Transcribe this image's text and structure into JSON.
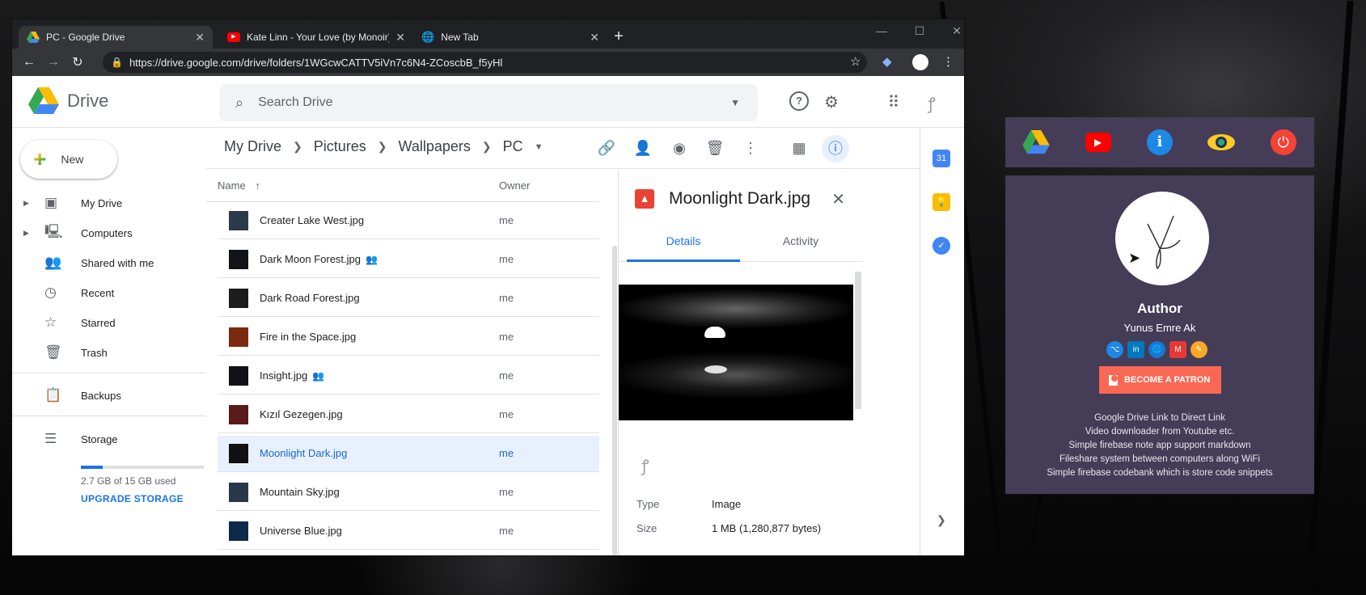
{
  "browser": {
    "tabs": [
      {
        "title": "PC - Google Drive",
        "icon": "google-drive-icon"
      },
      {
        "title": "Kate Linn - Your Love (by Monoir)",
        "icon": "youtube-icon"
      },
      {
        "title": "New Tab",
        "icon": "globe-icon"
      }
    ],
    "url": "https://drive.google.com/drive/folders/1WGcwCATTV5iVn7c6N4-ZCoscbB_f5yHl"
  },
  "drive": {
    "app_name": "Drive",
    "search_placeholder": "Search Drive",
    "new_label": "New",
    "nav": [
      {
        "label": "My Drive",
        "icon": "my-drive-icon",
        "expandable": true
      },
      {
        "label": "Computers",
        "icon": "computers-icon",
        "expandable": true
      },
      {
        "label": "Shared with me",
        "icon": "shared-icon",
        "expandable": false
      },
      {
        "label": "Recent",
        "icon": "clock-icon",
        "expandable": false
      },
      {
        "label": "Starred",
        "icon": "star-icon",
        "expandable": false
      },
      {
        "label": "Trash",
        "icon": "trash-icon",
        "expandable": false
      },
      {
        "label": "Backups",
        "icon": "backups-icon",
        "expandable": false
      }
    ],
    "storage": {
      "label": "Storage",
      "used_text": "2.7 GB of 15 GB used",
      "used_fraction": 0.18,
      "upgrade_label": "UPGRADE STORAGE"
    },
    "breadcrumbs": [
      "My Drive",
      "Pictures",
      "Wallpapers",
      "PC"
    ],
    "list": {
      "name_header": "Name",
      "owner_header": "Owner",
      "rows": [
        {
          "name": "Creater Lake West.jpg",
          "owner": "me",
          "shared": false,
          "selected": false
        },
        {
          "name": "Dark Moon Forest.jpg",
          "owner": "me",
          "shared": true,
          "selected": false
        },
        {
          "name": "Dark Road Forest.jpg",
          "owner": "me",
          "shared": false,
          "selected": false
        },
        {
          "name": "Fire in the Space.jpg",
          "owner": "me",
          "shared": false,
          "selected": false
        },
        {
          "name": "Insight.jpg",
          "owner": "me",
          "shared": true,
          "selected": false
        },
        {
          "name": "Kızıl Gezegen.jpg",
          "owner": "me",
          "shared": false,
          "selected": false
        },
        {
          "name": "Moonlight Dark.jpg",
          "owner": "me",
          "shared": false,
          "selected": true
        },
        {
          "name": "Mountain Sky.jpg",
          "owner": "me",
          "shared": false,
          "selected": false
        },
        {
          "name": "Universe Blue.jpg",
          "owner": "me",
          "shared": false,
          "selected": false
        }
      ]
    },
    "details": {
      "title": "Moonlight Dark.jpg",
      "tab_details": "Details",
      "tab_activity": "Activity",
      "type_label": "Type",
      "type_value": "Image",
      "size_label": "Size",
      "size_value": "1 MB (1,280,877 bytes)"
    }
  },
  "extension": {
    "nav_icons": [
      "google-drive-icon",
      "youtube-icon",
      "info-icon",
      "eye-icon",
      "power-icon"
    ],
    "author_title": "Author",
    "author_name": "Yunus Emre Ak",
    "socials": [
      "github-icon",
      "linkedin-icon",
      "globe-icon",
      "gmail-icon",
      "blog-icon"
    ],
    "patron_label": "BECOME A PATRON",
    "features": [
      "Google Drive Link to Direct Link",
      "Video downloader from Youtube etc.",
      "Simple firebase note app support markdown",
      "Fileshare system between computers along WiFi",
      "Simple firebase codebank which is store code snippets"
    ]
  },
  "colors": {
    "accent": "#1a73e8",
    "extension_bg": "#453c58",
    "patron": "#f96854"
  }
}
